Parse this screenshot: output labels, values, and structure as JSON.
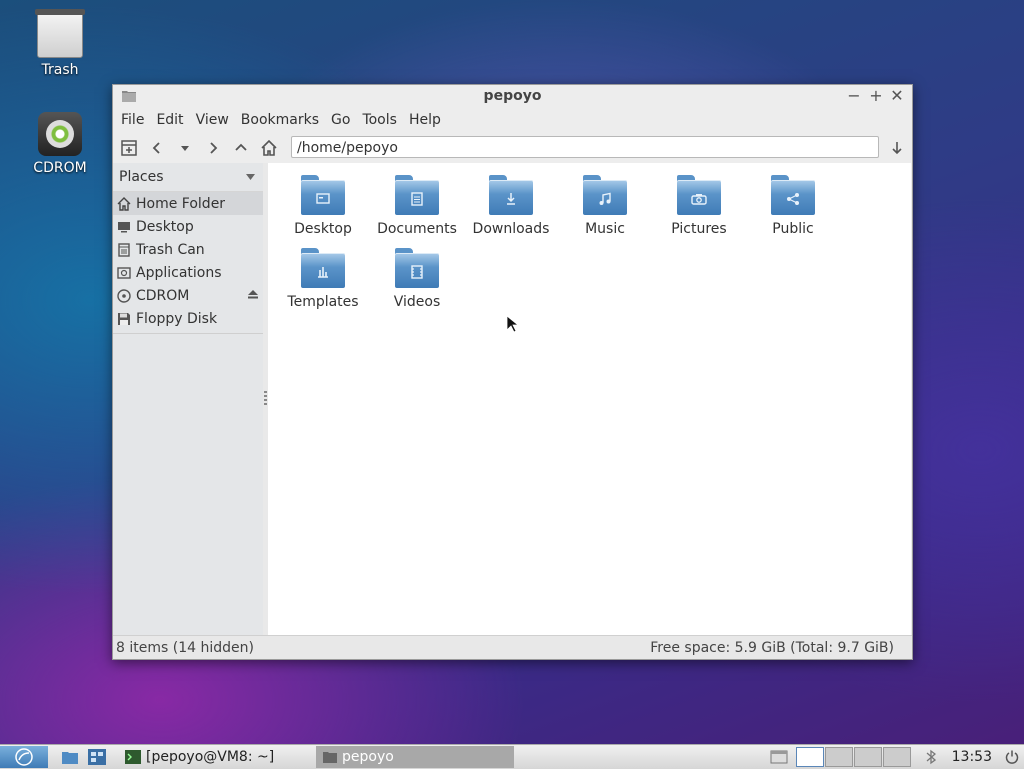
{
  "desktop": {
    "icons": [
      {
        "label": "Trash"
      },
      {
        "label": "CDROM"
      }
    ]
  },
  "window": {
    "title": "pepoyo",
    "controls": {
      "minimize": "−",
      "maximize": "+",
      "close": "✕"
    }
  },
  "menu": [
    "File",
    "Edit",
    "View",
    "Bookmarks",
    "Go",
    "Tools",
    "Help"
  ],
  "location": {
    "path": "/home/pepoyo"
  },
  "sidebar": {
    "header": "Places",
    "items": [
      {
        "label": "Home Folder",
        "icon": "home-icon",
        "active": true
      },
      {
        "label": "Desktop",
        "icon": "desktop-icon"
      },
      {
        "label": "Trash Can",
        "icon": "trash-icon"
      },
      {
        "label": "Applications",
        "icon": "applications-icon"
      },
      {
        "label": "CDROM",
        "icon": "cdrom-icon"
      },
      {
        "label": "Floppy Disk",
        "icon": "floppy-icon"
      }
    ]
  },
  "files": [
    {
      "label": "Desktop",
      "emblem": "desktop"
    },
    {
      "label": "Documents",
      "emblem": "document"
    },
    {
      "label": "Downloads",
      "emblem": "download"
    },
    {
      "label": "Music",
      "emblem": "music"
    },
    {
      "label": "Pictures",
      "emblem": "camera"
    },
    {
      "label": "Public",
      "emblem": "share"
    },
    {
      "label": "Templates",
      "emblem": "template"
    },
    {
      "label": "Videos",
      "emblem": "video"
    }
  ],
  "status": {
    "left": "8 items (14 hidden)",
    "right": "Free space: 5.9 GiB (Total: 9.7 GiB)"
  },
  "taskbar": {
    "tasks": [
      {
        "label": "[pepoyo@VM8: ~]",
        "active": false
      },
      {
        "label": "pepoyo",
        "active": true
      }
    ],
    "clock": "13:53"
  },
  "colors": {
    "folder": "#4f8bc4",
    "selection": "#d4d6d9"
  }
}
